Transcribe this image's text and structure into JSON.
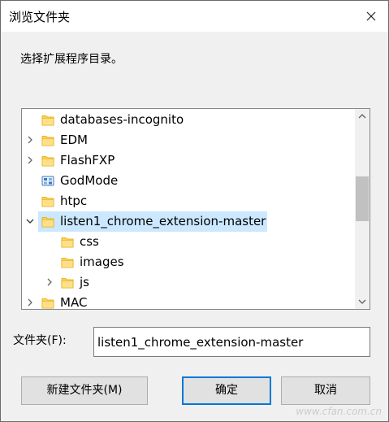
{
  "window": {
    "title": "浏览文件夹",
    "prompt": "选择扩展程序目录。"
  },
  "tree": {
    "items": [
      {
        "label": "databases-incognito",
        "level": 0,
        "expander": "none",
        "icon": "folder-icon",
        "selected": false
      },
      {
        "label": "EDM",
        "level": 0,
        "expander": "collapsed",
        "icon": "folder-icon",
        "selected": false
      },
      {
        "label": "FlashFXP",
        "level": 0,
        "expander": "collapsed",
        "icon": "folder-icon",
        "selected": false
      },
      {
        "label": "GodMode",
        "level": 0,
        "expander": "none",
        "icon": "control-panel-icon",
        "selected": false
      },
      {
        "label": "htpc",
        "level": 0,
        "expander": "none",
        "icon": "folder-icon",
        "selected": false
      },
      {
        "label": "listen1_chrome_extension-master",
        "level": 0,
        "expander": "expanded",
        "icon": "folder-icon",
        "selected": true
      },
      {
        "label": "css",
        "level": 1,
        "expander": "none",
        "icon": "folder-icon",
        "selected": false
      },
      {
        "label": "images",
        "level": 1,
        "expander": "none",
        "icon": "folder-icon",
        "selected": false
      },
      {
        "label": "js",
        "level": 1,
        "expander": "collapsed",
        "icon": "folder-icon",
        "selected": false
      },
      {
        "label": "MAC",
        "level": 0,
        "expander": "collapsed",
        "icon": "folder-icon",
        "selected": false
      }
    ],
    "scrollbar": {
      "thumb_start": 0.31,
      "thumb_size": 0.26
    }
  },
  "folder": {
    "label": "文件夹(F):",
    "value": "listen1_chrome_extension-master"
  },
  "buttons": {
    "new_folder": "新建文件夹(M)",
    "ok": "确定",
    "cancel": "取消"
  },
  "watermark": "www.cfan.com.cn",
  "colors": {
    "selection": "#cce8ff",
    "accent": "#0078d7",
    "folder": "#ffd05b"
  }
}
